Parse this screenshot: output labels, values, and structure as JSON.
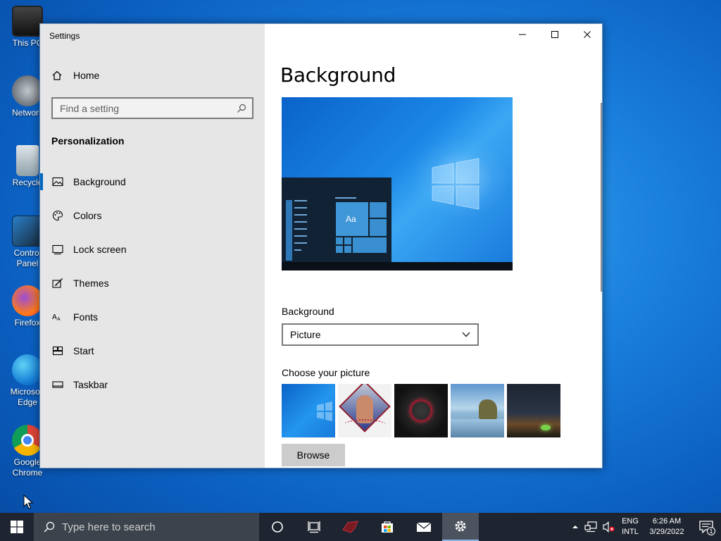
{
  "desktop": {
    "icons": [
      {
        "label": "This PC",
        "icon": "computer-icon"
      },
      {
        "label": "Network",
        "icon": "network-icon"
      },
      {
        "label": "Recycle",
        "icon": "recycle-bin-icon"
      },
      {
        "label": "Control Panel",
        "icon": "control-panel-icon"
      },
      {
        "label": "Firefox",
        "icon": "firefox-icon"
      },
      {
        "label": "Microsoft Edge",
        "icon": "edge-icon"
      },
      {
        "label": "Google Chrome",
        "icon": "chrome-icon"
      }
    ]
  },
  "window": {
    "app_title": "Settings",
    "left": {
      "home_label": "Home",
      "search_placeholder": "Find a setting",
      "section_title": "Personalization",
      "nav": [
        {
          "label": "Background",
          "icon": "picture-icon",
          "active": true
        },
        {
          "label": "Colors",
          "icon": "palette-icon",
          "active": false
        },
        {
          "label": "Lock screen",
          "icon": "lock-screen-icon",
          "active": false
        },
        {
          "label": "Themes",
          "icon": "themes-icon",
          "active": false
        },
        {
          "label": "Fonts",
          "icon": "fonts-icon",
          "active": false
        },
        {
          "label": "Start",
          "icon": "start-icon",
          "active": false
        },
        {
          "label": "Taskbar",
          "icon": "taskbar-icon",
          "active": false
        }
      ]
    },
    "main": {
      "page_title": "Background",
      "preview_tile_label": "Aa",
      "background_label": "Background",
      "background_value": "Picture",
      "choose_label": "Choose your picture",
      "browse_label": "Browse"
    }
  },
  "taskbar": {
    "search_placeholder": "Type here to search",
    "lang_line1": "ENG",
    "lang_line2": "INTL",
    "time": "6:26 AM",
    "date": "3/29/2022",
    "notification_count": "1"
  },
  "colors": {
    "accent": "#0067c0",
    "nav_bg": "#e6e6e6",
    "taskbar_bg": "#1f2530"
  }
}
